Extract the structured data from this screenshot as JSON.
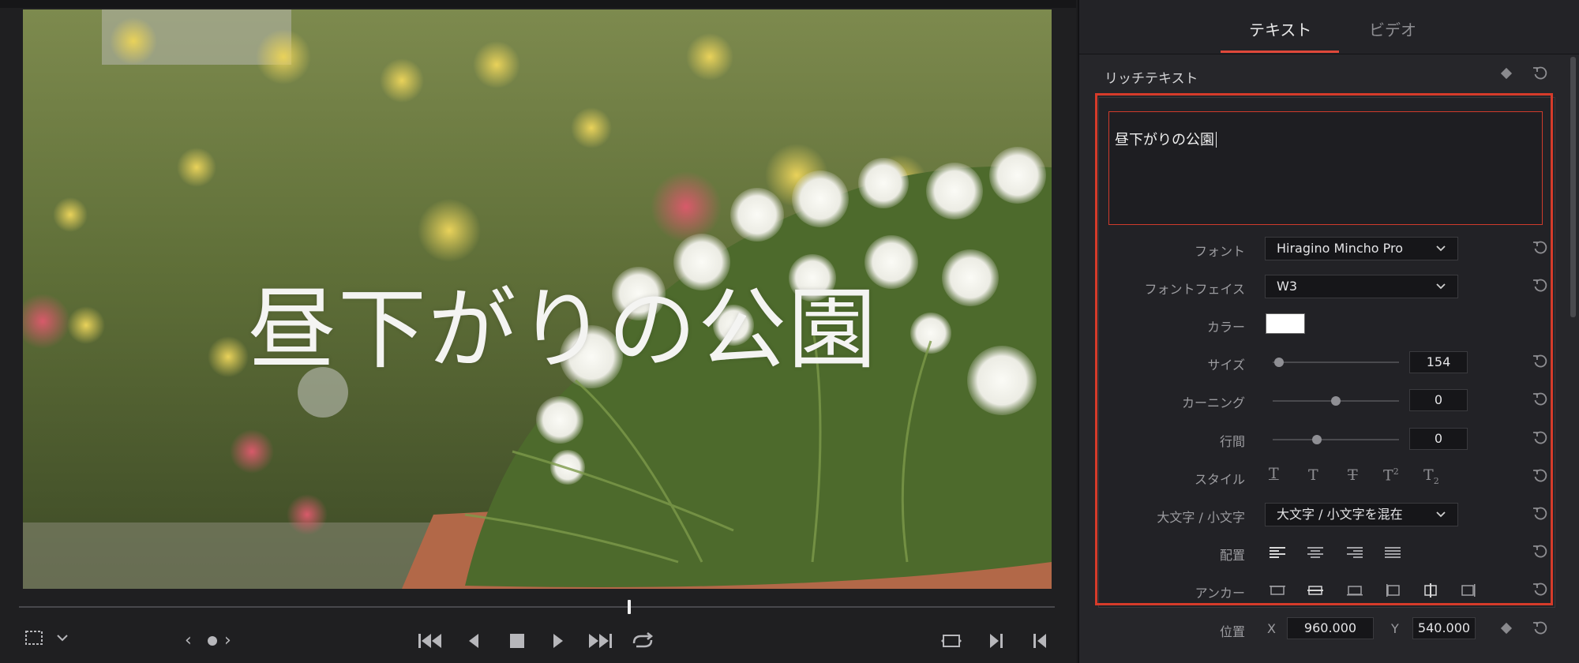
{
  "viewer": {
    "title_overlay": "昼下がりの公園",
    "controls": {
      "view_options_icon": "transform-icon",
      "nav_prev": "‹",
      "nav_next": "›"
    }
  },
  "inspector": {
    "tabs": [
      {
        "label": "テキスト",
        "active": true
      },
      {
        "label": "ビデオ",
        "active": false
      }
    ],
    "section_title": "リッチテキスト",
    "text_value": "昼下がりの公園",
    "font": {
      "label": "フォント",
      "value": "Hiragino Mincho Pro"
    },
    "font_face": {
      "label": "フォントフェイス",
      "value": "W3"
    },
    "color": {
      "label": "カラー",
      "value": "#ffffff"
    },
    "size": {
      "label": "サイズ",
      "value": "154",
      "slider_fraction": 0.05
    },
    "kerning": {
      "label": "カーニング",
      "value": "0",
      "slider_fraction": 0.5
    },
    "line_spacing": {
      "label": "行間",
      "value": "0",
      "slider_fraction": 0.35
    },
    "style": {
      "label": "スタイル"
    },
    "case": {
      "label": "大文字 / 小文字",
      "value": "大文字 / 小文字を混在"
    },
    "alignment": {
      "label": "配置"
    },
    "anchor": {
      "label": "アンカー"
    },
    "position": {
      "label": "位置",
      "x_label": "X",
      "x_value": "960.000",
      "y_label": "Y",
      "y_value": "540.000"
    }
  },
  "colors": {
    "accent_red": "#d63b2a",
    "panel_bg": "#26262a"
  }
}
